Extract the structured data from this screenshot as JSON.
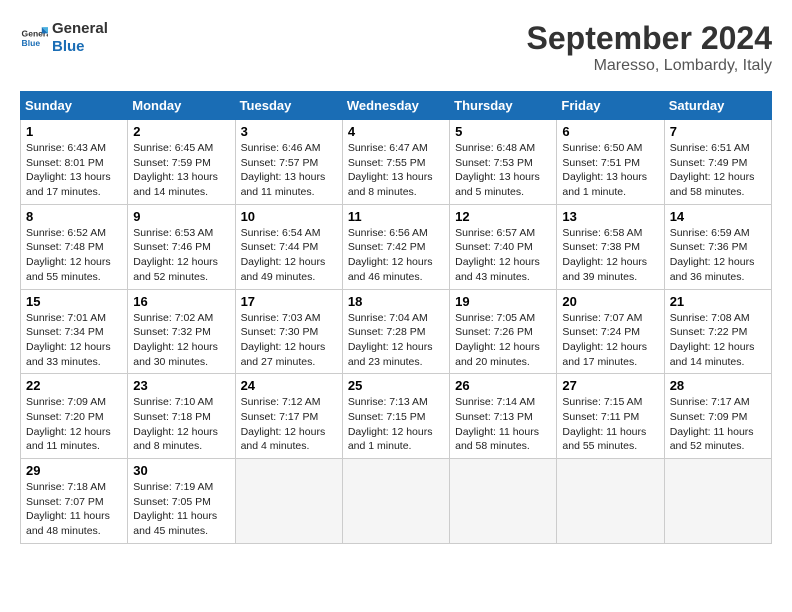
{
  "logo": {
    "line1": "General",
    "line2": "Blue"
  },
  "title": "September 2024",
  "subtitle": "Maresso, Lombardy, Italy",
  "headers": [
    "Sunday",
    "Monday",
    "Tuesday",
    "Wednesday",
    "Thursday",
    "Friday",
    "Saturday"
  ],
  "weeks": [
    [
      {
        "day": "1",
        "info": "Sunrise: 6:43 AM\nSunset: 8:01 PM\nDaylight: 13 hours\nand 17 minutes."
      },
      {
        "day": "2",
        "info": "Sunrise: 6:45 AM\nSunset: 7:59 PM\nDaylight: 13 hours\nand 14 minutes."
      },
      {
        "day": "3",
        "info": "Sunrise: 6:46 AM\nSunset: 7:57 PM\nDaylight: 13 hours\nand 11 minutes."
      },
      {
        "day": "4",
        "info": "Sunrise: 6:47 AM\nSunset: 7:55 PM\nDaylight: 13 hours\nand 8 minutes."
      },
      {
        "day": "5",
        "info": "Sunrise: 6:48 AM\nSunset: 7:53 PM\nDaylight: 13 hours\nand 5 minutes."
      },
      {
        "day": "6",
        "info": "Sunrise: 6:50 AM\nSunset: 7:51 PM\nDaylight: 13 hours\nand 1 minute."
      },
      {
        "day": "7",
        "info": "Sunrise: 6:51 AM\nSunset: 7:49 PM\nDaylight: 12 hours\nand 58 minutes."
      }
    ],
    [
      {
        "day": "8",
        "info": "Sunrise: 6:52 AM\nSunset: 7:48 PM\nDaylight: 12 hours\nand 55 minutes."
      },
      {
        "day": "9",
        "info": "Sunrise: 6:53 AM\nSunset: 7:46 PM\nDaylight: 12 hours\nand 52 minutes."
      },
      {
        "day": "10",
        "info": "Sunrise: 6:54 AM\nSunset: 7:44 PM\nDaylight: 12 hours\nand 49 minutes."
      },
      {
        "day": "11",
        "info": "Sunrise: 6:56 AM\nSunset: 7:42 PM\nDaylight: 12 hours\nand 46 minutes."
      },
      {
        "day": "12",
        "info": "Sunrise: 6:57 AM\nSunset: 7:40 PM\nDaylight: 12 hours\nand 43 minutes."
      },
      {
        "day": "13",
        "info": "Sunrise: 6:58 AM\nSunset: 7:38 PM\nDaylight: 12 hours\nand 39 minutes."
      },
      {
        "day": "14",
        "info": "Sunrise: 6:59 AM\nSunset: 7:36 PM\nDaylight: 12 hours\nand 36 minutes."
      }
    ],
    [
      {
        "day": "15",
        "info": "Sunrise: 7:01 AM\nSunset: 7:34 PM\nDaylight: 12 hours\nand 33 minutes."
      },
      {
        "day": "16",
        "info": "Sunrise: 7:02 AM\nSunset: 7:32 PM\nDaylight: 12 hours\nand 30 minutes."
      },
      {
        "day": "17",
        "info": "Sunrise: 7:03 AM\nSunset: 7:30 PM\nDaylight: 12 hours\nand 27 minutes."
      },
      {
        "day": "18",
        "info": "Sunrise: 7:04 AM\nSunset: 7:28 PM\nDaylight: 12 hours\nand 23 minutes."
      },
      {
        "day": "19",
        "info": "Sunrise: 7:05 AM\nSunset: 7:26 PM\nDaylight: 12 hours\nand 20 minutes."
      },
      {
        "day": "20",
        "info": "Sunrise: 7:07 AM\nSunset: 7:24 PM\nDaylight: 12 hours\nand 17 minutes."
      },
      {
        "day": "21",
        "info": "Sunrise: 7:08 AM\nSunset: 7:22 PM\nDaylight: 12 hours\nand 14 minutes."
      }
    ],
    [
      {
        "day": "22",
        "info": "Sunrise: 7:09 AM\nSunset: 7:20 PM\nDaylight: 12 hours\nand 11 minutes."
      },
      {
        "day": "23",
        "info": "Sunrise: 7:10 AM\nSunset: 7:18 PM\nDaylight: 12 hours\nand 8 minutes."
      },
      {
        "day": "24",
        "info": "Sunrise: 7:12 AM\nSunset: 7:17 PM\nDaylight: 12 hours\nand 4 minutes."
      },
      {
        "day": "25",
        "info": "Sunrise: 7:13 AM\nSunset: 7:15 PM\nDaylight: 12 hours\nand 1 minute."
      },
      {
        "day": "26",
        "info": "Sunrise: 7:14 AM\nSunset: 7:13 PM\nDaylight: 11 hours\nand 58 minutes."
      },
      {
        "day": "27",
        "info": "Sunrise: 7:15 AM\nSunset: 7:11 PM\nDaylight: 11 hours\nand 55 minutes."
      },
      {
        "day": "28",
        "info": "Sunrise: 7:17 AM\nSunset: 7:09 PM\nDaylight: 11 hours\nand 52 minutes."
      }
    ],
    [
      {
        "day": "29",
        "info": "Sunrise: 7:18 AM\nSunset: 7:07 PM\nDaylight: 11 hours\nand 48 minutes."
      },
      {
        "day": "30",
        "info": "Sunrise: 7:19 AM\nSunset: 7:05 PM\nDaylight: 11 hours\nand 45 minutes."
      },
      {
        "day": "",
        "info": ""
      },
      {
        "day": "",
        "info": ""
      },
      {
        "day": "",
        "info": ""
      },
      {
        "day": "",
        "info": ""
      },
      {
        "day": "",
        "info": ""
      }
    ]
  ]
}
